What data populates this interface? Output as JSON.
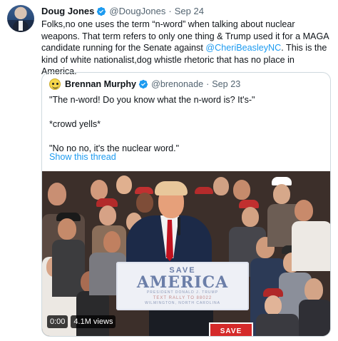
{
  "tweet": {
    "name": "Doug Jones",
    "handle": "@DougJones",
    "separator": "·",
    "date": "Sep 24",
    "text_part1": "Folks,no one uses the term “n-word” when talking about nuclear weapons. That term refers to only one thing & Trump used it for a MAGA candidate running for the Senate against ",
    "mention": "@CheriBeasleyNC",
    "text_part2": ". This is the kind of white nationalist,dog whistle rhetoric that has no place in America."
  },
  "quote": {
    "name": "Brennan Murphy",
    "handle": "@brenonade",
    "separator": "·",
    "date": "Sep 23",
    "lines": [
      "\"The n-word! Do you know what the n-word is? It's-\"",
      "*crowd yells*",
      "\"No no no, it's the nuclear word.\""
    ],
    "show_thread": "Show this thread"
  },
  "video": {
    "time": "0:00",
    "views": "4.1M views",
    "podium_sign": {
      "save": "SAVE",
      "america": "AMERICA",
      "small": "PRESIDENT DONALD J. TRUMP",
      "rally": "TEXT RALLY TO 88022",
      "location": "WILMINGTON, NORTH CAROLINA"
    },
    "held_sign": "SAVE"
  },
  "colors": {
    "link": "#1d9bf0",
    "verified": "#1d9bf0",
    "secondary_text": "#536471",
    "border": "#cfd9de"
  }
}
